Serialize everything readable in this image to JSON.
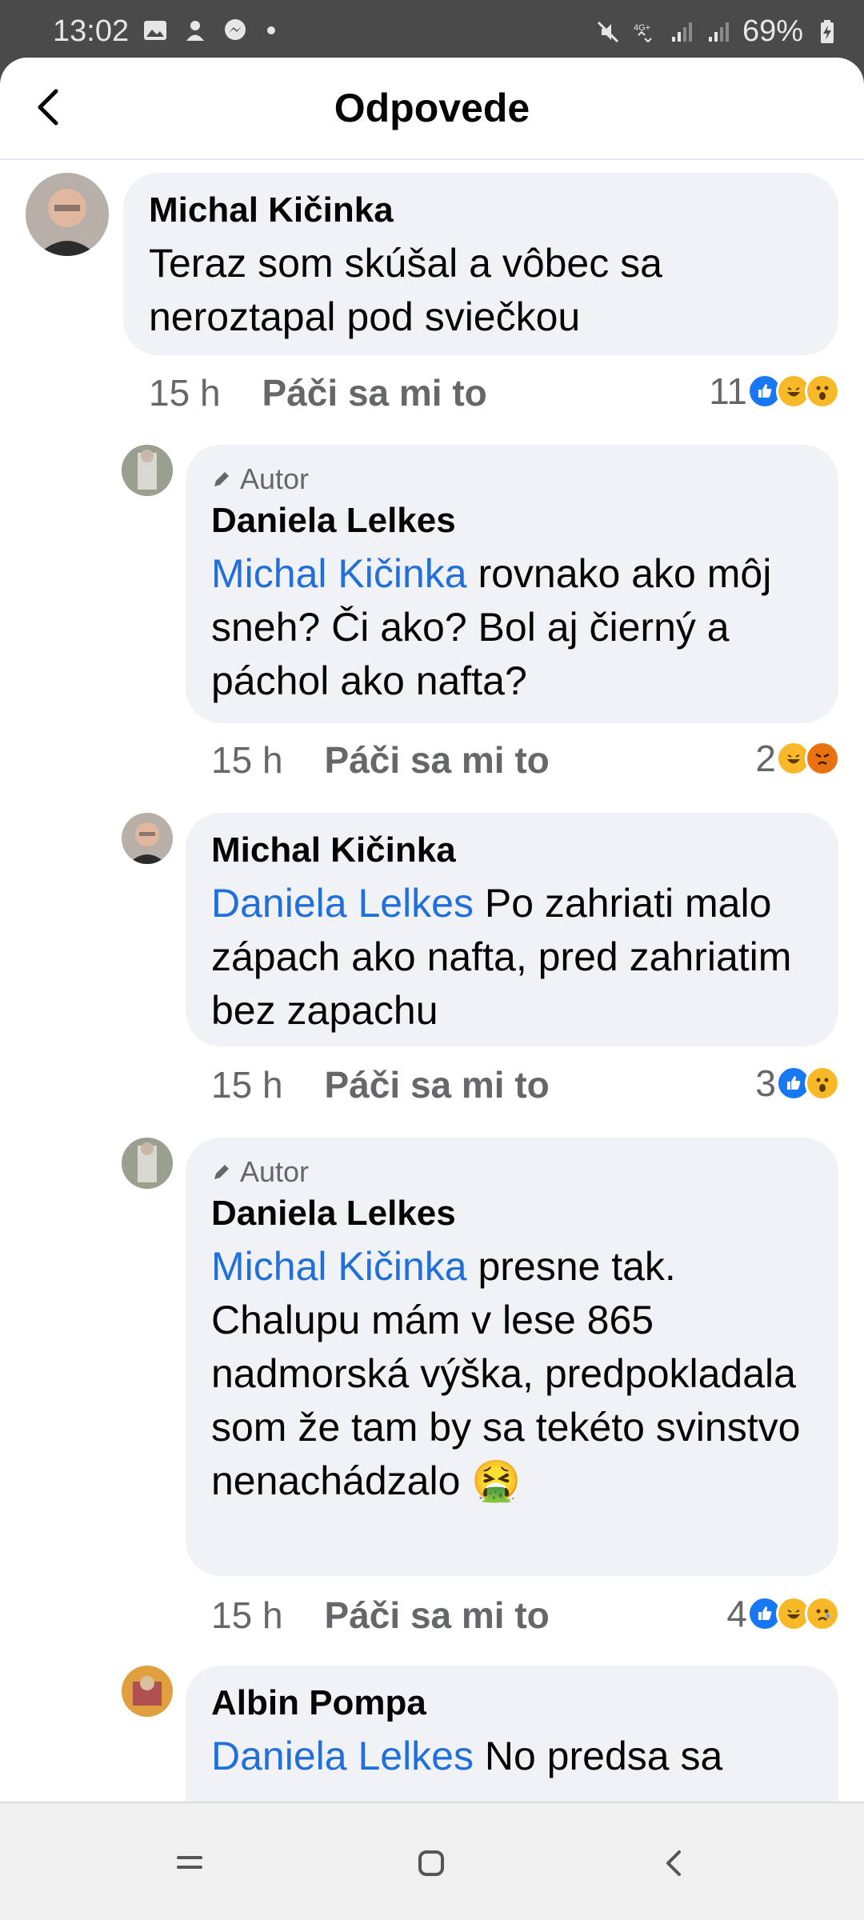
{
  "status_bar": {
    "time": "13:02",
    "battery": "69%",
    "network": "4G+"
  },
  "header": {
    "title": "Odpovede"
  },
  "comments": [
    {
      "author": "Michal Kičinka",
      "author_badge": "",
      "mention": "",
      "text": "Teraz som skúšal a vôbec sa neroztapal pod sviečkou",
      "time": "15 h",
      "like_label": "Páči sa mi to",
      "reaction_count": "11",
      "reactions": [
        "like",
        "haha",
        "wow"
      ]
    },
    {
      "author": "Daniela Lelkes",
      "author_badge": "Autor",
      "mention": "Michal Kičinka",
      "text": " rovnako ako môj sneh? Či ako? Bol aj čierný a páchol ako nafta?",
      "time": "15 h",
      "like_label": "Páči sa mi to",
      "reaction_count": "2",
      "reactions": [
        "haha",
        "angry"
      ]
    },
    {
      "author": "Michal Kičinka",
      "author_badge": "",
      "mention": "Daniela Lelkes",
      "text": " Po zahriati malo zápach ako nafta, pred zahriatim bez zapachu",
      "time": "15 h",
      "like_label": "Páči sa mi to",
      "reaction_count": "3",
      "reactions": [
        "like",
        "wow"
      ]
    },
    {
      "author": "Daniela Lelkes",
      "author_badge": "Autor",
      "mention": "Michal Kičinka",
      "text": " presne tak. Chalupu mám v lese 865 nadmorská výška, predpokladala som že tam by sa tekéto svinstvo nenachádzalo 🤮",
      "time": "15 h",
      "like_label": "Páči sa mi to",
      "reaction_count": "4",
      "reactions": [
        "like",
        "haha",
        "sad"
      ]
    },
    {
      "author": "Albin Pompa",
      "author_badge": "",
      "mention": "Daniela Lelkes",
      "text": " No predsa sa",
      "time": "",
      "like_label": "",
      "reaction_count": "",
      "reactions": []
    }
  ],
  "colors": {
    "mention": "#216fdb",
    "bubble": "#f0f2f5",
    "like_blue": "#1877f2"
  }
}
